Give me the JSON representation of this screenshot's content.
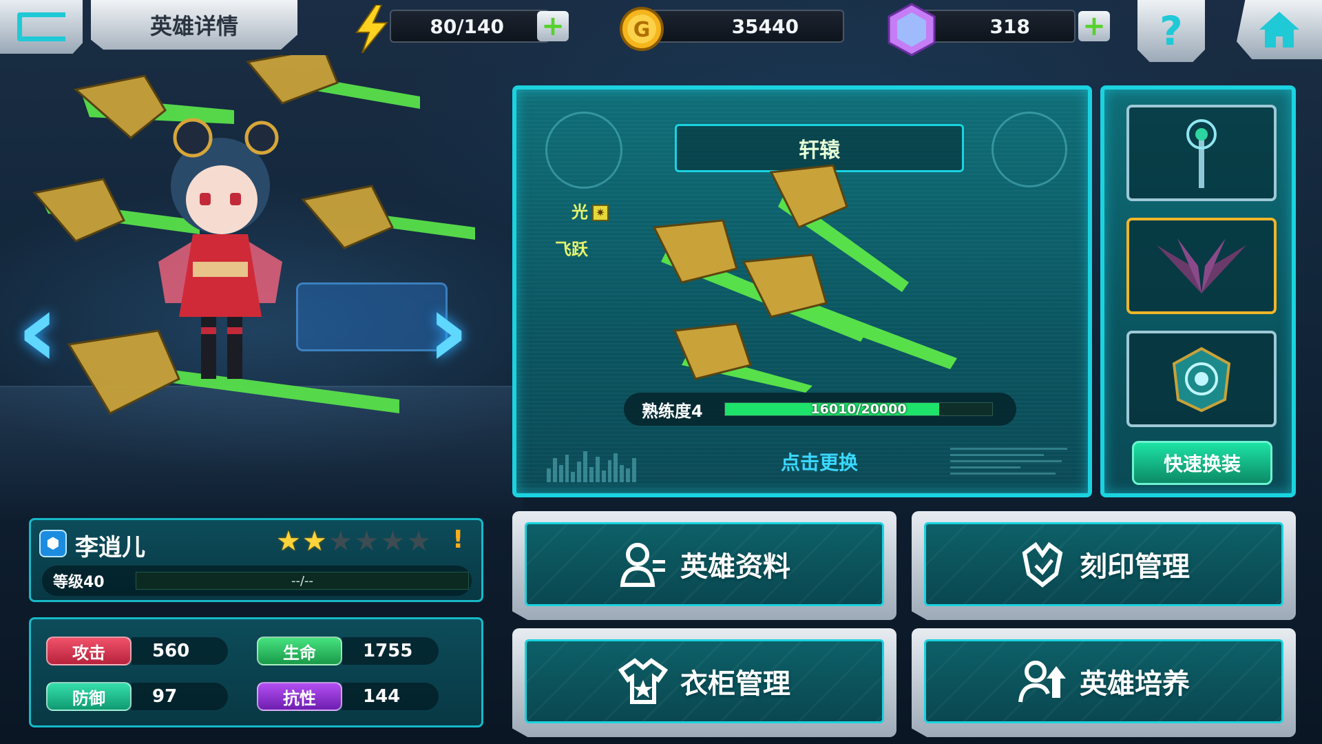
{
  "header": {
    "title": "英雄详情",
    "energy": "80/140",
    "gold": "35440",
    "gems": "318",
    "colors": {
      "energy_icon": "#ffd21f",
      "gold_icon": "#f5b51c",
      "gem_icon": "#c57cf4",
      "plus": "#56d12e",
      "accent": "#1fc9d6"
    }
  },
  "weapon": {
    "name": "轩辕",
    "element": "光",
    "trait": "飞跃",
    "mastery_label": "熟练度4",
    "mastery_value": "16010/20000",
    "mastery_fraction": 0.8005,
    "change_label": "点击更换"
  },
  "equipment": {
    "slots": [
      {
        "icon": "staff-icon",
        "active": false
      },
      {
        "icon": "wings-icon",
        "active": true
      },
      {
        "icon": "emblem-icon",
        "active": false
      }
    ],
    "quick_change_label": "快速换装"
  },
  "hero": {
    "name": "李逍儿",
    "stars_filled": 2,
    "stars_total": 6,
    "alert": "!",
    "level_label": "等级40",
    "exp_text": "--/--"
  },
  "stats": {
    "attack_label": "攻击",
    "attack_value": "560",
    "hp_label": "生命",
    "hp_value": "1755",
    "defense_label": "防御",
    "defense_value": "97",
    "resist_label": "抗性",
    "resist_value": "144"
  },
  "menu": {
    "hero_info": "英雄资料",
    "imprint": "刻印管理",
    "wardrobe": "衣柜管理",
    "training": "英雄培养"
  }
}
